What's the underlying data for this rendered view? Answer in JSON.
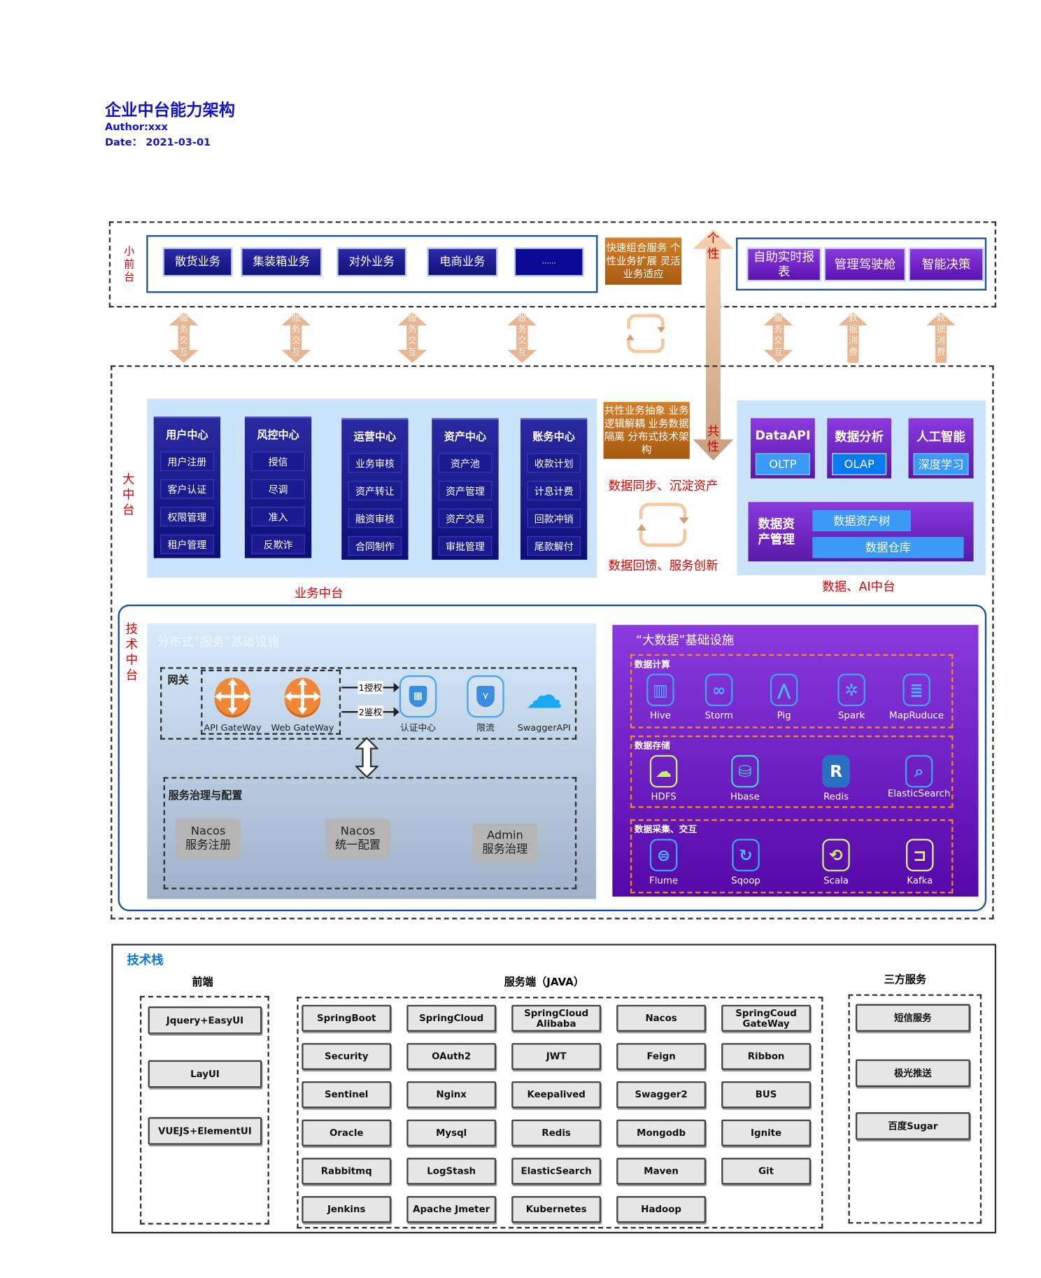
{
  "header": {
    "title": "企业中台能力架构",
    "author": "Author:xxx",
    "date": "Date： 2021-03-01"
  },
  "front": {
    "label": "小前台",
    "business": [
      "散货业务",
      "集装箱业务",
      "对外业务",
      "电商业务",
      "......"
    ],
    "note": "快速组合服务 个性业务扩展 灵活业务适应",
    "data_apps": [
      "自助实时报表",
      "管理驾驶舱",
      "智能决策"
    ]
  },
  "vertical_arrow": {
    "top": "个性",
    "bottom": "共性"
  },
  "connectors": [
    "服务交互",
    "服务交互",
    "服务交互",
    "服务交互",
    "服务交互",
    "数据消费",
    "数据消费"
  ],
  "middle": {
    "label": "大中台",
    "business_label": "业务中台",
    "centers": [
      {
        "title": "用户中心",
        "items": [
          "用户注册",
          "客户认证",
          "权限管理",
          "租户管理"
        ]
      },
      {
        "title": "风控中心",
        "items": [
          "授信",
          "尽调",
          "准入",
          "反欺诈"
        ]
      },
      {
        "title": "运营中心",
        "items": [
          "业务审核",
          "资产转让",
          "融资审核",
          "合同制作"
        ]
      },
      {
        "title": "资产中心",
        "items": [
          "资产池",
          "资产管理",
          "资产交易",
          "审批管理"
        ]
      },
      {
        "title": "账务中心",
        "items": [
          "收款计划",
          "计息计费",
          "回款冲销",
          "尾款解付"
        ]
      }
    ],
    "note": "共性业务抽象 业务逻辑解耦 业务数据隔离 分布式技术架构",
    "sync_text": "数据同步、沉淀资产",
    "feedback_text": "数据回馈、服务创新",
    "data_label": "数据、AI中台",
    "data_cards": [
      {
        "title": "DataAPI",
        "sub": "OLTP"
      },
      {
        "title": "数据分析",
        "sub": "OLAP"
      },
      {
        "title": "人工智能",
        "sub": "深度学习"
      }
    ],
    "asset": {
      "title": "数据资产管理",
      "tree": "数据资产树",
      "warehouse": "数据仓库"
    }
  },
  "tech": {
    "label": "技术中台",
    "service_title": "分布式“服务”基础设施",
    "gateway_title": "网关",
    "gateways": [
      "API GateWay",
      "Web GateWay"
    ],
    "steps": [
      "1授权",
      "2鉴权"
    ],
    "gateway_services": [
      "认证中心",
      "限流",
      "SwaggerAPI"
    ],
    "governance_title": "服务治理与配置",
    "governance": [
      [
        "Nacos",
        "服务注册"
      ],
      [
        "Nacos",
        "统一配置"
      ],
      [
        "Admin",
        "服务治理"
      ]
    ],
    "bigdata_title": "“大数据”基础设施",
    "groups": [
      {
        "title": "数据计算",
        "items": [
          "Hive",
          "Storm",
          "Pig",
          "Spark",
          "MapRuduce"
        ]
      },
      {
        "title": "数据存储",
        "items": [
          "HDFS",
          "Hbase",
          "Redis",
          "ElasticSearch"
        ]
      },
      {
        "title": "数据采集、交互",
        "items": [
          "Flume",
          "Sqoop",
          "Scala",
          "Kafka"
        ]
      }
    ]
  },
  "stack": {
    "title": "技术栈",
    "frontend_title": "前端",
    "server_title": "服务端（JAVA）",
    "third_title": "三方服务",
    "frontend": [
      "Jquery+EasyUI",
      "LayUI",
      "VUEJS+ElementUI"
    ],
    "server": [
      "SpringBoot",
      "SpringCloud",
      "SpringCloud Alibaba",
      "Nacos",
      "SpringCoud GateWay",
      "Security",
      "OAuth2",
      "JWT",
      "Feign",
      "Ribbon",
      "Sentinel",
      "Nginx",
      "Keepalived",
      "Swagger2",
      "BUS",
      "Oracle",
      "Mysql",
      "Redis",
      "Mongodb",
      "Ignite",
      "Rabbitmq",
      "LogStash",
      "ElasticSearch",
      "Maven",
      "Git",
      "Jenkins",
      "Apache Jmeter",
      "Kubernetes",
      "Hadoop"
    ],
    "third": [
      "短信服务",
      "极光推送",
      "百度Sugar"
    ]
  },
  "colors": {
    "title": "#1212c8",
    "label_red": "#dd0000",
    "navy": "#1a1a90",
    "purple": "#6a20c0",
    "orange": "#c0701e",
    "stack_title": "#0a7ae0"
  }
}
